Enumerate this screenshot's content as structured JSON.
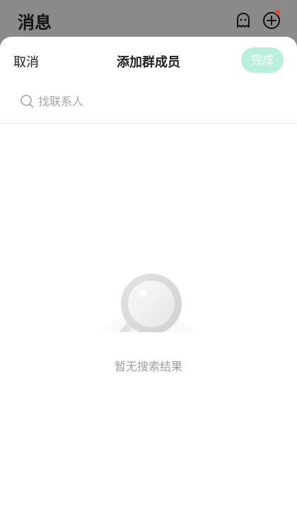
{
  "background": {
    "title": "消息",
    "icons": [
      "ghost-icon",
      "add-circle-icon"
    ],
    "notification_dot_color": "#e04b3a"
  },
  "nav": {
    "cancel_label": "取消",
    "title": "添加群成员",
    "done_label": "完成",
    "done_color": "#b9efdd"
  },
  "search": {
    "placeholder": "找联系人",
    "value": ""
  },
  "empty_state": {
    "message": "暂无搜索结果"
  }
}
